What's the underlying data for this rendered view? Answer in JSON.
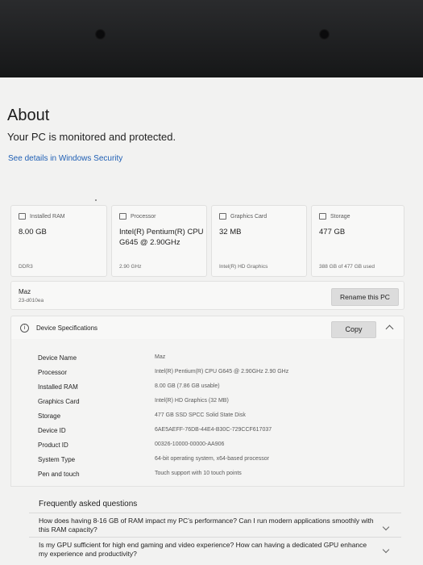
{
  "header": {
    "title": "About",
    "status": "Your PC is monitored and protected.",
    "security_link": "See details in Windows Security"
  },
  "cards": [
    {
      "icon": "ram-icon",
      "label": "Installed RAM",
      "value": "8.00 GB",
      "sub": "DDR3"
    },
    {
      "icon": "processor-icon",
      "label": "Processor",
      "value": "Intel(R) Pentium(R) CPU G645 @ 2.90GHz",
      "sub": "2.90 GHz"
    },
    {
      "icon": "graphics-card-icon",
      "label": "Graphics Card",
      "value": "32 MB",
      "sub": "Intel(R) HD Graphics"
    },
    {
      "icon": "storage-icon",
      "label": "Storage",
      "value": "477 GB",
      "sub": "388 GB of 477 GB used"
    }
  ],
  "pc": {
    "name": "Maz",
    "model": "23-d010ea",
    "rename_label": "Rename this PC"
  },
  "specs": {
    "title": "Device Specifications",
    "copy_label": "Copy",
    "rows": [
      {
        "label": "Device Name",
        "value": "Maz"
      },
      {
        "label": "Processor",
        "value": "Intel(R) Pentium(R) CPU G645 @ 2.90GHz   2.90 GHz"
      },
      {
        "label": "Installed RAM",
        "value": "8.00 GB (7.86 GB usable)"
      },
      {
        "label": "Graphics Card",
        "value": "Intel(R) HD Graphics (32 MB)"
      },
      {
        "label": "Storage",
        "value": "477 GB SSD SPCC Solid State Disk"
      },
      {
        "label": "Device ID",
        "value": "6AE5AEFF-76DB-44E4-B30C-729CCF617037"
      },
      {
        "label": "Product ID",
        "value": "00326-10000-00000-AA906"
      },
      {
        "label": "System Type",
        "value": "64-bit operating system, x64-based processor"
      },
      {
        "label": "Pen and touch",
        "value": "Touch support with 10 touch points"
      }
    ]
  },
  "faq": {
    "title": "Frequently asked questions",
    "items": [
      {
        "question": "How does having 8-16 GB of RAM impact my PC’s performance? Can I run modern applications smoothly with this RAM capacity?"
      },
      {
        "question": "Is my GPU sufficient for high end gaming and video experience? How can having a dedicated GPU enhance my experience and productivity?"
      }
    ]
  }
}
